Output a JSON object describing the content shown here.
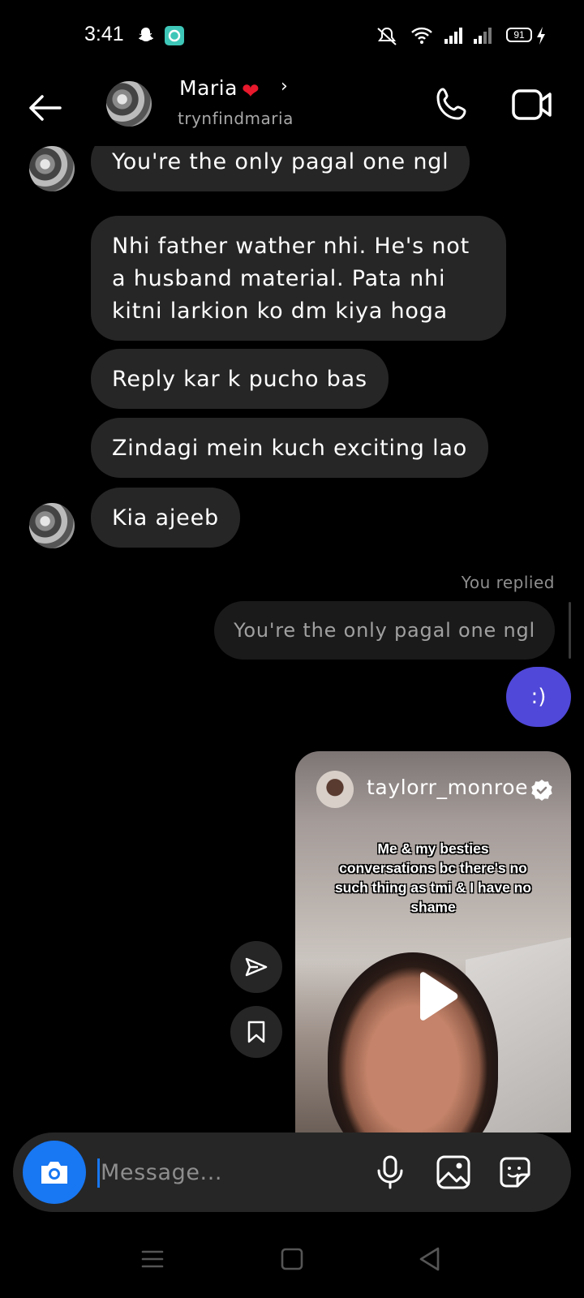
{
  "status_bar": {
    "time": "3:41",
    "battery": "91"
  },
  "header": {
    "name": "Maria",
    "username": "trynfindmaria"
  },
  "messages": [
    {
      "text": "You're the only pagal one ngl"
    },
    {
      "text": "Nhi father wather nhi. He's not a husband material. Pata nhi kitni larkion ko dm kiya hoga"
    },
    {
      "text": "Reply kar k pucho bas"
    },
    {
      "text": "Zindagi mein kuch exciting lao"
    },
    {
      "text": "Kia ajeeb"
    }
  ],
  "reply": {
    "label": "You replied",
    "quoted": "You're the only pagal one ngl",
    "sent": ":)"
  },
  "reel": {
    "username": "taylorr_monroe",
    "caption": "Me & my besties conversations bc there's no such thing as tmi & I have no shame"
  },
  "composer": {
    "placeholder": "Message..."
  },
  "icons": {
    "back": "arrow-left-icon",
    "call": "phone-icon",
    "video": "video-camera-icon",
    "camera": "camera-icon",
    "mic": "microphone-icon",
    "gallery": "image-icon",
    "sticker": "sticker-icon",
    "share": "send-icon",
    "save": "bookmark-icon",
    "play": "play-icon",
    "verified": "verified-badge-icon"
  },
  "colors": {
    "accent": "#1877f2",
    "sent_bubble": "#5048d8",
    "received_bubble": "#262626",
    "heart": "#e8192c"
  }
}
